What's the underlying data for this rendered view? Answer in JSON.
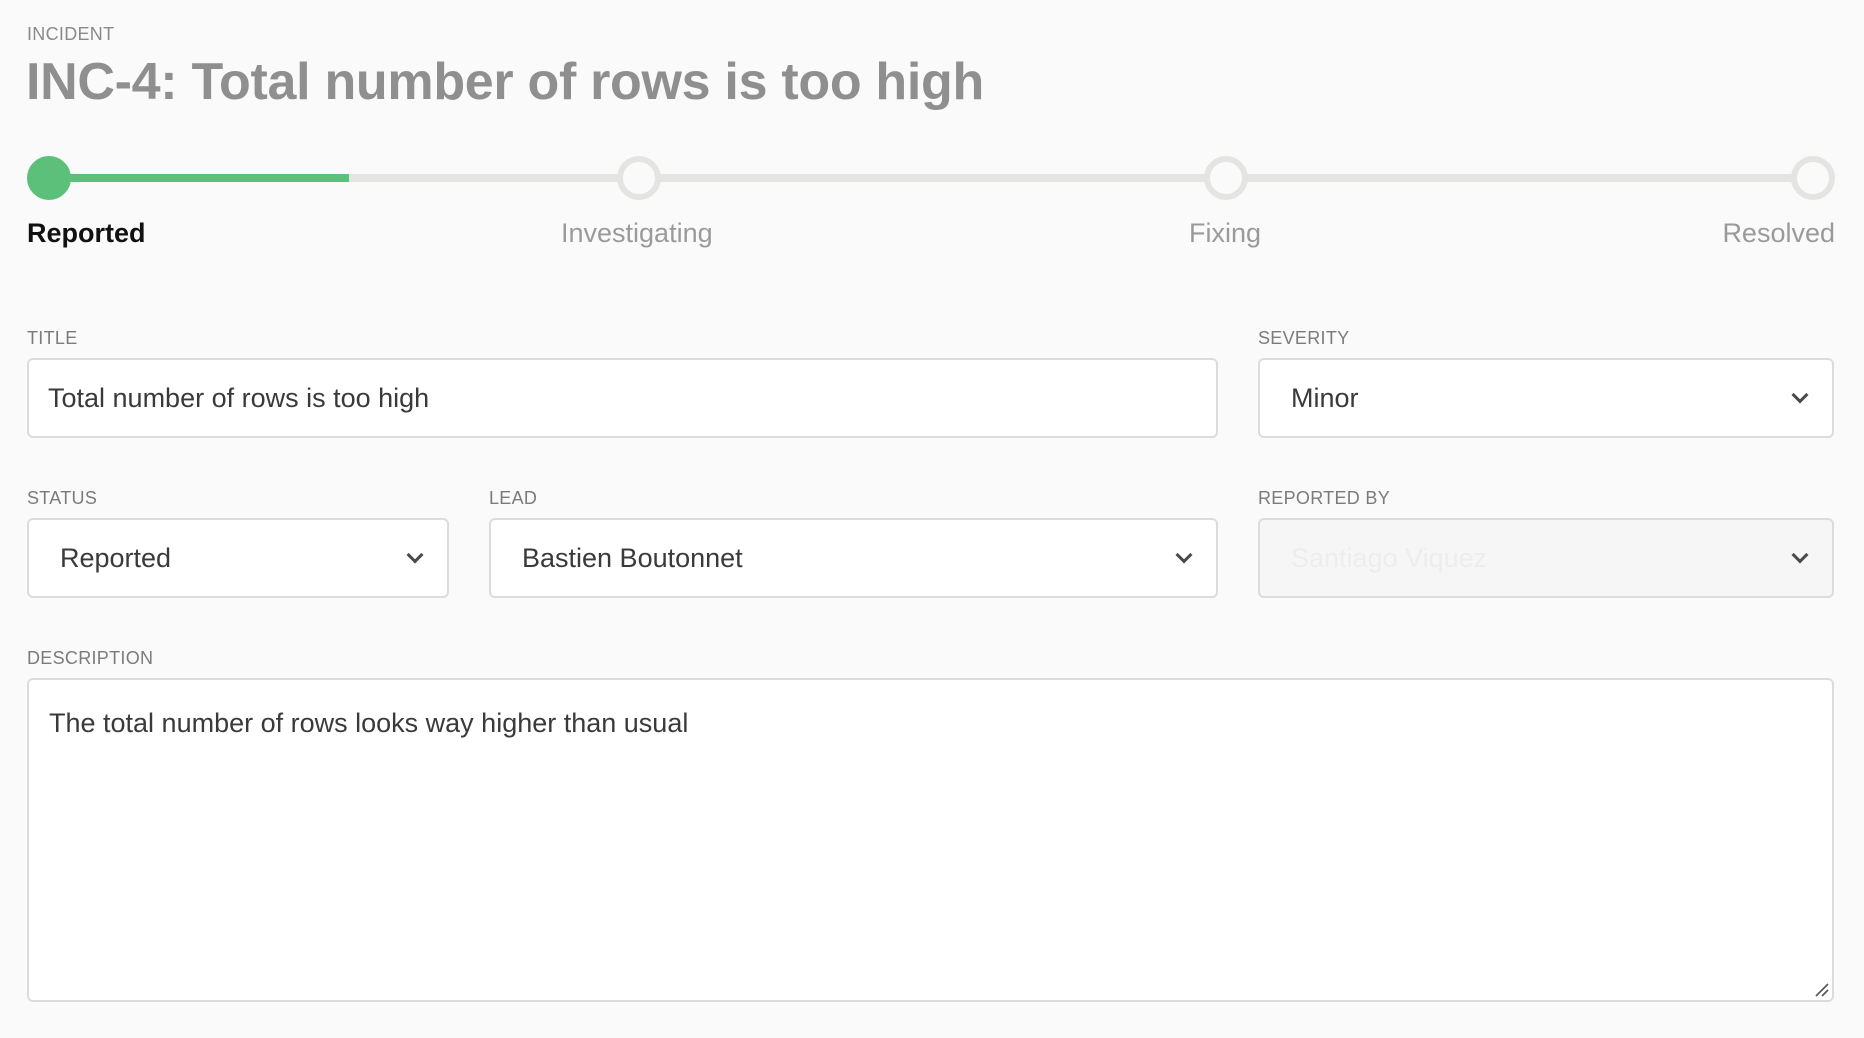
{
  "header": {
    "eyebrow": "INCIDENT",
    "title": "INC-4: Total number of rows is too high"
  },
  "stepper": {
    "progress_percent": 17,
    "steps": [
      {
        "label": "Reported",
        "state": "done"
      },
      {
        "label": "Investigating",
        "state": "pending"
      },
      {
        "label": "Fixing",
        "state": "pending"
      },
      {
        "label": "Resolved",
        "state": "pending"
      }
    ]
  },
  "form": {
    "title": {
      "label": "TITLE",
      "value": "Total number of rows is too high"
    },
    "severity": {
      "label": "SEVERITY",
      "value": "Minor"
    },
    "status": {
      "label": "STATUS",
      "value": "Reported"
    },
    "lead": {
      "label": "LEAD",
      "value": "Bastien Boutonnet"
    },
    "reported_by": {
      "label": "REPORTED BY",
      "value": "Santiago Viquez"
    },
    "description": {
      "label": "DESCRIPTION",
      "value": "The total number of rows looks way higher than usual"
    }
  },
  "colors": {
    "accent": "#5cc07a",
    "track": "#e4e4e2",
    "background": "#fafafa"
  },
  "icons": {
    "select_arrow": "chevron-down-icon",
    "resize": "resize-grip-icon"
  }
}
